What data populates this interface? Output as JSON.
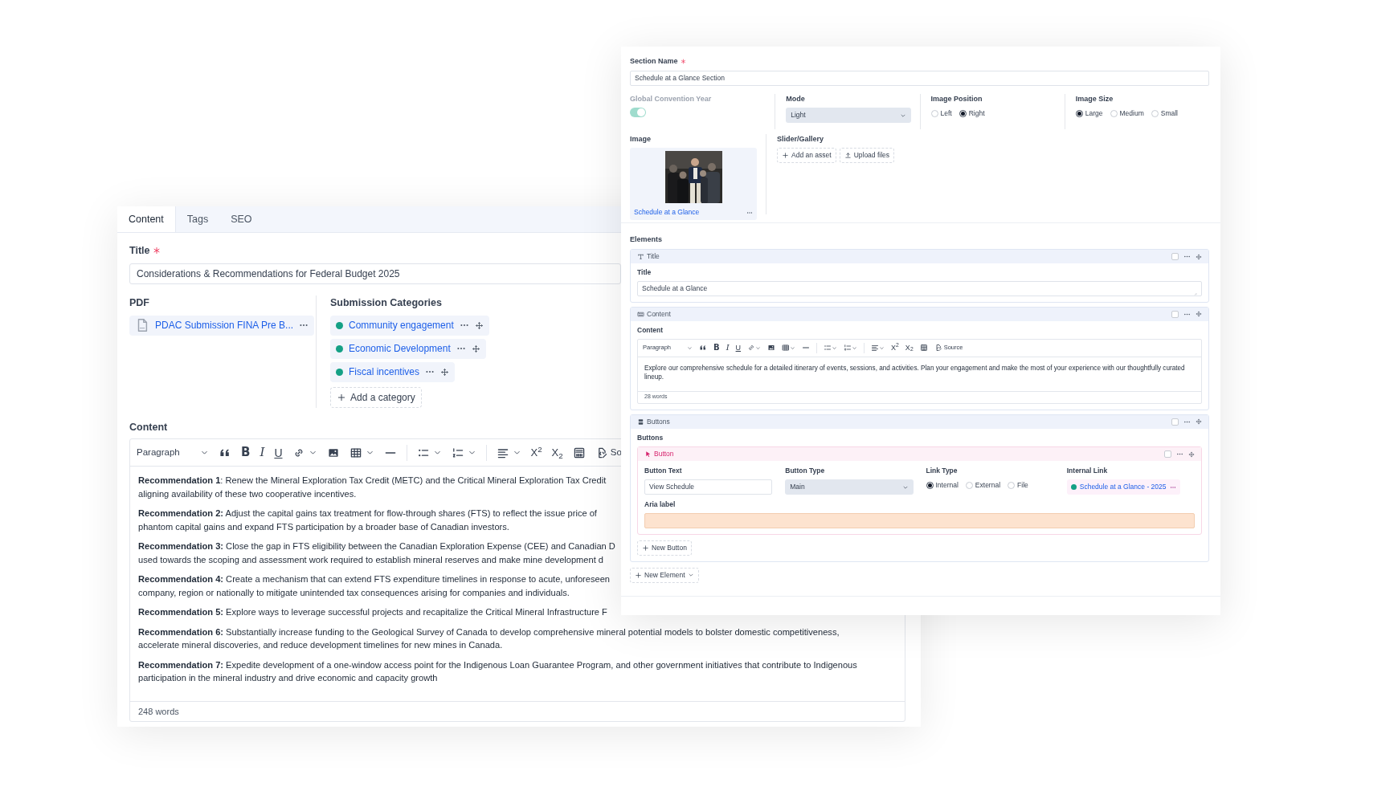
{
  "back": {
    "tabs": [
      {
        "label": "Content",
        "selected": true
      },
      {
        "label": "Tags",
        "selected": false
      },
      {
        "label": "SEO",
        "selected": false
      }
    ],
    "title_field": {
      "label": "Title",
      "required": true,
      "value": "Considerations & Recommendations for Federal Budget 2025"
    },
    "pdf": {
      "label": "PDF",
      "file": "PDAC Submission FINA Pre B..."
    },
    "categories": {
      "label": "Submission Categories",
      "items": [
        {
          "label": "Community engagement",
          "color": "#14a085"
        },
        {
          "label": "Economic Development",
          "color": "#14a085"
        },
        {
          "label": "Fiscal incentives",
          "color": "#14a085"
        }
      ],
      "add_label": "Add a category"
    },
    "content": {
      "label": "Content",
      "toolbar": {
        "paragraph": "Paragraph",
        "glyphs": [
          "B",
          "I",
          "U"
        ],
        "scripts": [
          "X$^{2}$",
          "X$_{2}$"
        ],
        "source": "So"
      },
      "paragraphs": [
        {
          "lines": [
            "**Recommendation 1**: Renew the Mineral Exploration Tax Credit (METC) and the Critical Mineral Exploration Tax Credit",
            "aligning availability of these two cooperative incentives."
          ]
        },
        {
          "lines": [
            "**Recommendation 2:** Adjust the capital gains tax treatment for flow-through shares (FTS) to reflect the issue price of",
            "phantom capital gains and expand FTS participation by a broader base of Canadian investors."
          ]
        },
        {
          "lines": [
            "**Recommendation 3:** Close the gap in FTS eligibility between the Canadian Exploration Expense (CEE) and Canadian D",
            "used towards the scoping and assessment work required to establish mineral reserves and make mine development d"
          ]
        },
        {
          "lines": [
            "**Recommendation 4:** Create a mechanism that can extend FTS expenditure timelines in response to acute, unforeseen",
            "company, region or nationally to mitigate unintended tax consequences arising for companies and individuals."
          ]
        },
        {
          "lines": [
            "**Recommendation 5:** Explore ways to leverage successful projects and recapitalize the Critical Mineral Infrastructure F"
          ]
        },
        {
          "lines": [
            "**Recommendation 6:** Substantially increase funding to the Geological Survey of Canada to develop comprehensive mineral potential models to bolster domestic competitiveness,",
            "accelerate mineral discoveries, and reduce development timelines for new mines in Canada."
          ]
        },
        {
          "lines": [
            "**Recommendation 7:** Expedite development of a one-window access point for the Indigenous Loan Guarantee Program, and other government initiatives that contribute to Indigenous",
            "participation in the mineral industry and drive economic and capacity growth"
          ]
        }
      ],
      "word_count": "248 words"
    }
  },
  "front": {
    "section_name": {
      "label": "Section Name",
      "required": true,
      "value": "Schedule at a Glance Section"
    },
    "convention_year": {
      "label": "Global Convention Year",
      "on": true,
      "disabled": true
    },
    "mode": {
      "label": "Mode",
      "value": "Light"
    },
    "image_position": {
      "label": "Image Position",
      "options": [
        {
          "label": "Left",
          "selected": false
        },
        {
          "label": "Right",
          "selected": true
        }
      ]
    },
    "image_size": {
      "label": "Image Size",
      "options": [
        {
          "label": "Large",
          "selected": true
        },
        {
          "label": "Medium",
          "selected": false
        },
        {
          "label": "Small",
          "selected": false
        }
      ]
    },
    "image": {
      "label": "Image",
      "caption": "Schedule at a Glance"
    },
    "slider": {
      "label": "Slider/Gallery",
      "buttons": [
        {
          "kind": "add",
          "label": "Add an asset"
        },
        {
          "kind": "upload",
          "label": "Upload files"
        }
      ]
    },
    "elements": {
      "label": "Elements",
      "items": [
        {
          "kind": "title",
          "header": "Title",
          "checked": false,
          "label": "Title",
          "value": "Schedule at a Glance"
        },
        {
          "kind": "content",
          "header": "Content",
          "checked": false,
          "label": "Content",
          "toolbar": {
            "paragraph": "Paragraph",
            "glyphs": [
              "B",
              "I",
              "U"
            ],
            "scripts": [
              "X$^{2}$",
              "X$_{2}$"
            ],
            "source": "Source"
          },
          "text": "Explore our comprehensive schedule for a detailed itinerary of events, sessions, and activities. Plan your engagement and make the most of your experience with our thoughtfully curated lineup.",
          "word_count": "28 words"
        },
        {
          "kind": "buttons",
          "header": "Buttons",
          "checked": false,
          "label": "Buttons",
          "buttons": [
            {
              "header": "Button",
              "checked": false,
              "text_label": "Button Text",
              "text_value": "View Schedule",
              "type_label": "Button Type",
              "type_value": "Main",
              "link_type_label": "Link Type",
              "link_types": [
                {
                  "label": "Internal",
                  "selected": true
                },
                {
                  "label": "External",
                  "selected": false
                },
                {
                  "label": "File",
                  "selected": false
                }
              ],
              "internal_link_label": "Internal Link",
              "internal_link": {
                "label": "Schedule at a Glance - 2025",
                "color": "#14a085"
              },
              "aria_label": "Aria label",
              "aria_invalid": true
            }
          ],
          "new_button": "New Button"
        }
      ],
      "new_element": "New Element"
    }
  }
}
